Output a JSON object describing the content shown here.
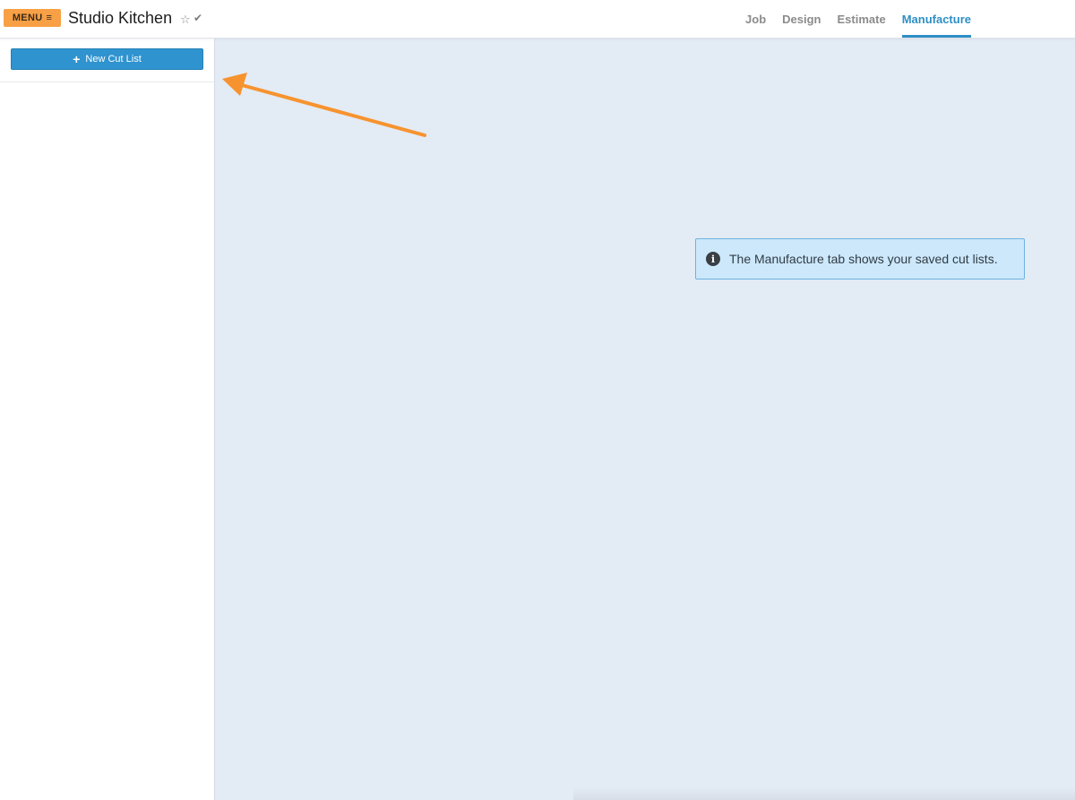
{
  "header": {
    "menu_label": "MENU",
    "menu_icon": "≡",
    "job_title": "Studio Kitchen",
    "star_icon": "☆",
    "check_icon": "✔",
    "tabs": [
      {
        "label": "Job",
        "active": false
      },
      {
        "label": "Design",
        "active": false
      },
      {
        "label": "Estimate",
        "active": false
      },
      {
        "label": "Manufacture",
        "active": true
      }
    ]
  },
  "sidebar": {
    "new_cut_list_icon": "+",
    "new_cut_list_label": "New Cut List"
  },
  "main": {
    "info_icon": "i",
    "info_message": "The Manufacture tab shows your saved cut lists."
  },
  "colors": {
    "menu_orange": "#f8a046",
    "accent_blue": "#2e8fc6",
    "main_background": "#e3ebf5",
    "info_background": "#cde8fb",
    "arrow_orange": "#f7932e"
  }
}
